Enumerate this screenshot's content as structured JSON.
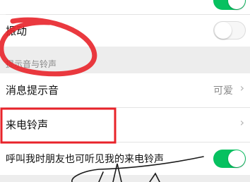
{
  "settings": {
    "vibrate_label": "振动",
    "section_header": "提示音与铃声",
    "message_tone_label": "消息提示音",
    "message_tone_value": "可爱",
    "ringtone_label": "来电铃声",
    "friend_hear_label": "呼叫我时朋友也可听见我的来电铃声"
  },
  "colors": {
    "toggle_on": "#07c160",
    "annotation_red": "#e8232a",
    "background": "#ededed"
  },
  "icons": {
    "chevron": "›"
  },
  "toggles": {
    "top_partial": true,
    "vibrate": false,
    "friend_hear": true
  }
}
